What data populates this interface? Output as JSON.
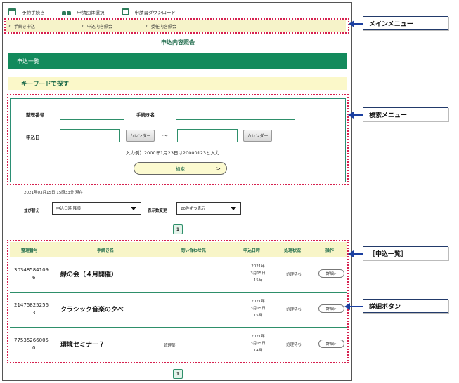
{
  "topnav": {
    "items": [
      {
        "label": "予約手続き",
        "icon": "calendar-icon"
      },
      {
        "label": "申請団体選択",
        "icon": "group-icon"
      },
      {
        "label": "申請書ダウンロード",
        "icon": "document-icon"
      }
    ]
  },
  "submenu": {
    "items": [
      {
        "label": "手続き申込"
      },
      {
        "label": "申込内容照会"
      },
      {
        "label": "委任内容照会"
      }
    ]
  },
  "page_title": "申込内容照会",
  "banner_title": "申込一覧",
  "keyword_heading": "キーワードで探す",
  "search": {
    "ref_label": "整理番号",
    "proc_label": "手続き名",
    "date_label": "申込日",
    "calendar_label": "カレンダー",
    "tilde": "～",
    "hint": "入力例）2000年1月23日は20000123と入力",
    "button_label": "検索",
    "button_arrow": ">"
  },
  "timestamp": "2021年03月15日 15時33分 現在",
  "sort": {
    "sort_label": "並び替え",
    "sort_value": "申込日時 降順",
    "count_label": "表示数変更",
    "count_value": "20件ずつ表示"
  },
  "pager": {
    "current": "1"
  },
  "table": {
    "headers": [
      "整理番号",
      "手続き名",
      "問い合わせ先",
      "申込日時",
      "処理状況",
      "操作"
    ],
    "rows": [
      {
        "ref1": "30348584109",
        "ref2": "6",
        "proc": "緑の会（４月開催）",
        "contact": "",
        "date1": "2021年",
        "date2": "3月15日",
        "date3": "15時",
        "status": "処理待ち",
        "action": "詳細>"
      },
      {
        "ref1": "21475825256",
        "ref2": "3",
        "proc": "クラシック音楽の夕べ",
        "contact": "",
        "date1": "2021年",
        "date2": "3月15日",
        "date3": "15時",
        "status": "処理待ち",
        "action": "詳細>"
      },
      {
        "ref1": "77535266005",
        "ref2": "0",
        "proc": "環境セミナー７",
        "contact": "管理部",
        "date1": "2021年",
        "date2": "3月15日",
        "date3": "14時",
        "status": "処理待ち",
        "action": "詳細>"
      }
    ]
  },
  "callouts": {
    "main_menu": "メインメニュー",
    "search_menu": "検索メニュー",
    "list": "［申込一覧］",
    "detail_button": "詳細ボタン"
  },
  "colors": {
    "brand_green": "#138a5c",
    "highlight_yellow": "#fbf8c9",
    "annotation_red": "#d6204e",
    "arrow_blue": "#1b3fa0"
  }
}
